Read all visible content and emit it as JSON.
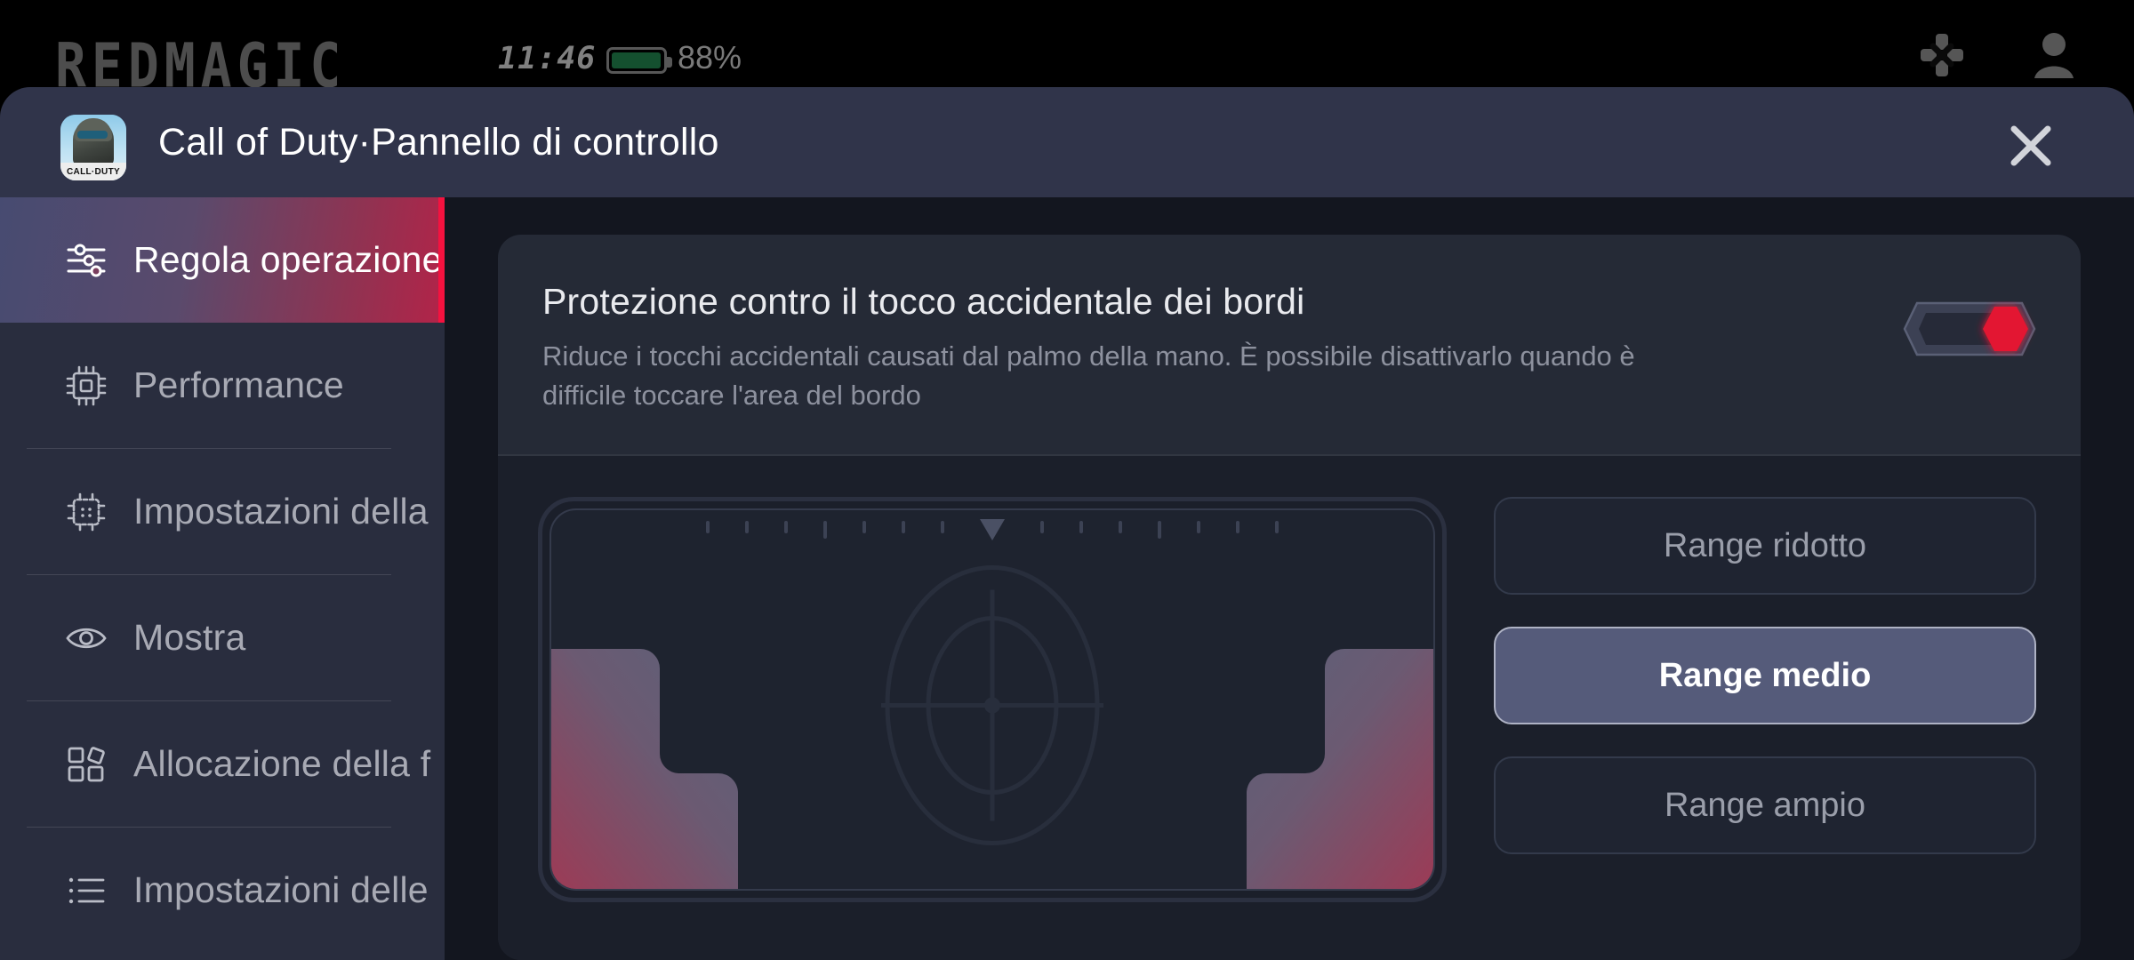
{
  "statusbar": {
    "brand": "REDMAGIC",
    "time": "11:46",
    "battery_percent": "88%",
    "battery_level": 88,
    "gamepad_icon": "gamepad-dpad-icon",
    "profile_icon": "user-profile-icon"
  },
  "header": {
    "title": "Call of Duty·Pannello di controllo",
    "app_icon_label": "CALL·DUTY",
    "close_icon": "close-icon"
  },
  "sidebar": {
    "items": [
      {
        "label": "Regola operazione",
        "icon": "sliders-icon",
        "active": true
      },
      {
        "label": "Performance",
        "icon": "cpu-chip-icon",
        "active": false
      },
      {
        "label": "Impostazioni della",
        "icon": "microchip-icon",
        "active": false
      },
      {
        "label": "Mostra",
        "icon": "eye-icon",
        "active": false
      },
      {
        "label": "Allocazione della f",
        "icon": "grid-diamond-icon",
        "active": false
      },
      {
        "label": "Impostazioni delle",
        "icon": "list-icon",
        "active": false
      }
    ]
  },
  "main": {
    "card": {
      "title": "Protezione contro il tocco accidentale dei bordi",
      "description": "Riduce i tocchi accidentali causati dal palmo della mano. È possibile disattivarlo quando è difficile toccare l'area del bordo",
      "toggle": {
        "name": "edge-touch-protection-toggle",
        "state": "on"
      }
    },
    "preview": {
      "name": "edge-protection-preview",
      "reticle_icon": "crosshair-scope-icon",
      "pointer_icon": "triangle-down-pointer-icon",
      "zone_label_left": "edge-zone-left",
      "zone_label_right": "edge-zone-right"
    },
    "range_options": [
      {
        "label": "Range ridotto",
        "selected": false
      },
      {
        "label": "Range medio",
        "selected": true
      },
      {
        "label": "Range ampio",
        "selected": false
      }
    ]
  },
  "colors": {
    "accent_red": "#f5123f",
    "toggle_on_red": "#e31430",
    "panel_bg": "#30344a",
    "content_bg": "#13161f",
    "card_bg": "#252a36",
    "card_body_bg": "#1b1f2a",
    "selected_btn": "#555b7a",
    "battery_green": "#14502f",
    "text_primary": "#ffffff",
    "text_muted": "#8d919e"
  }
}
